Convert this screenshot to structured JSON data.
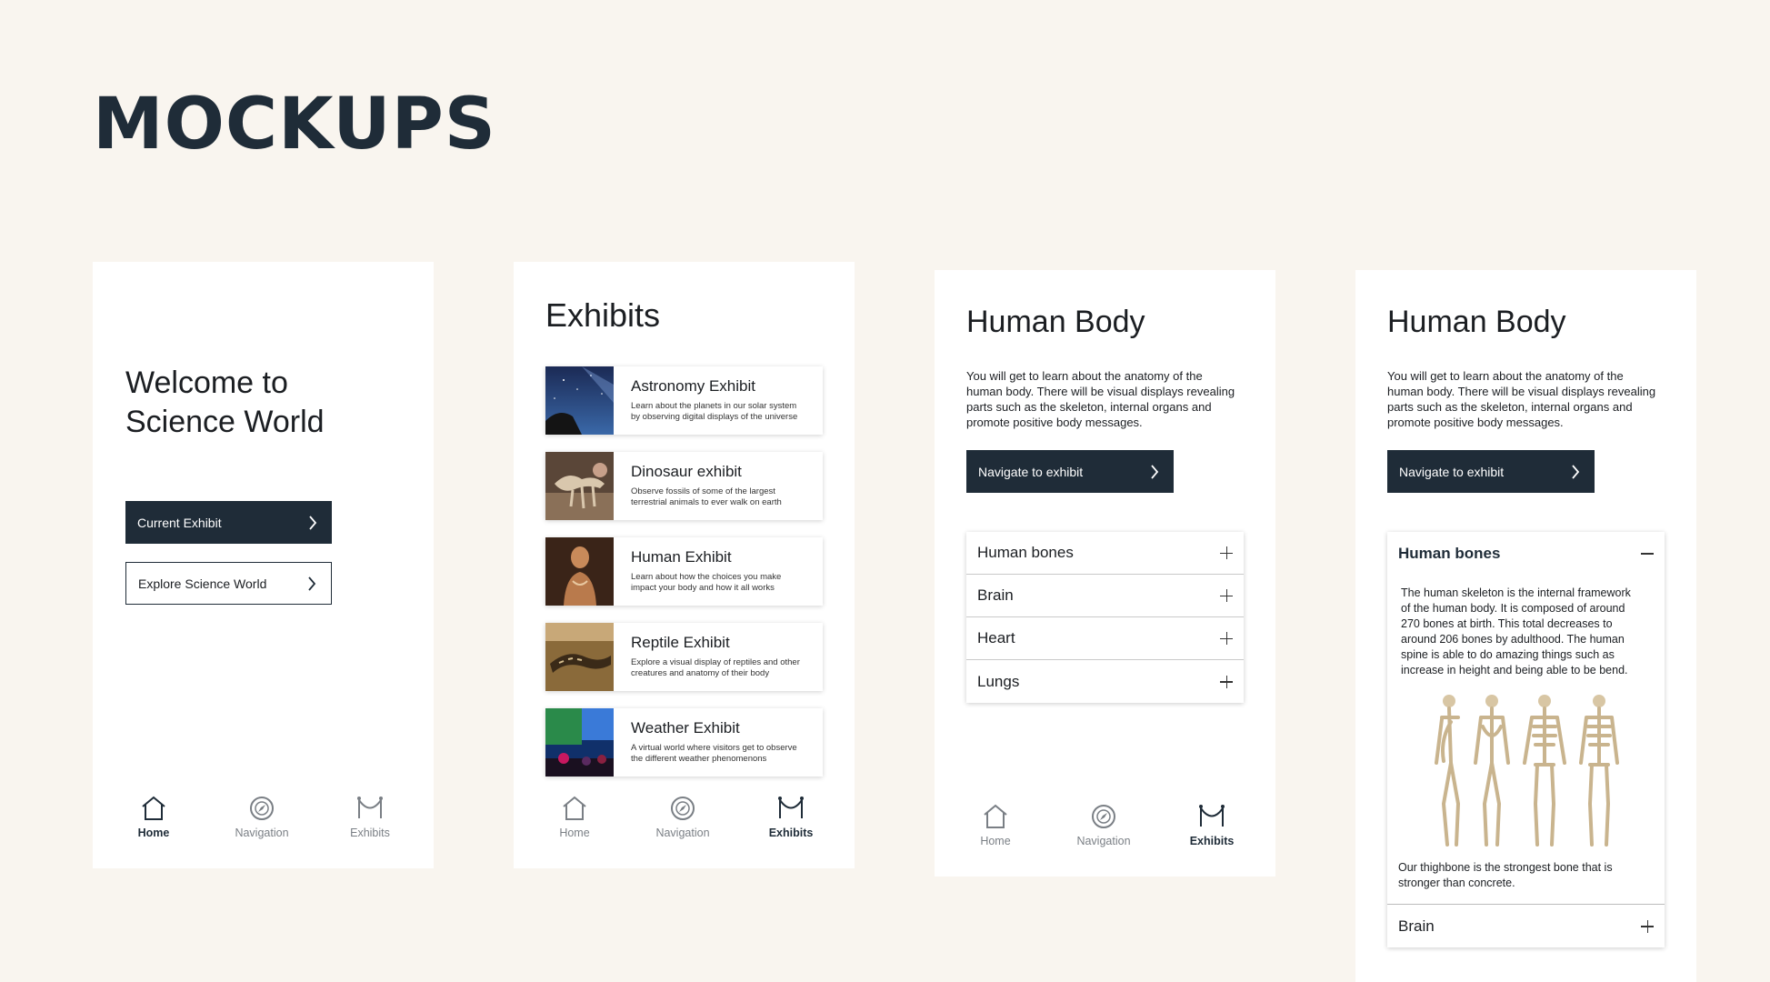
{
  "heading": "MOCKUPS",
  "nav": {
    "home": "Home",
    "navigation": "Navigation",
    "exhibits": "Exhibits"
  },
  "home_screen": {
    "welcome_line1": "Welcome to",
    "welcome_line2": "Science World",
    "current_exhibit_button": "Current Exhibit",
    "explore_button": "Explore Science World"
  },
  "exhibits_screen": {
    "title": "Exhibits",
    "cards": [
      {
        "title": "Astronomy Exhibit",
        "line1": "Learn about the planets in our solar system",
        "line2": "by observing digital displays of the universe"
      },
      {
        "title": "Dinosaur exhibit",
        "line1": "Observe fossils of some of the largest",
        "line2": "terrestrial animals to ever walk on earth"
      },
      {
        "title": "Human Exhibit",
        "line1": "Learn about how the choices you make",
        "line2": "impact your body and how it all works"
      },
      {
        "title": "Reptile Exhibit",
        "line1": "Explore a visual display of reptiles and other",
        "line2": "creatures and anatomy of their body"
      },
      {
        "title": "Weather Exhibit",
        "line1": "A virtual world where visitors get to observe",
        "line2": "the different weather phenomenons"
      }
    ]
  },
  "human_body_screen": {
    "title": "Human Body",
    "description_lines": [
      "You will get to learn about the anatomy of the",
      "human body. There will be visual displays revealing",
      "parts such as the skeleton, internal organs and",
      "promote positive body messages."
    ],
    "navigate_button": "Navigate to exhibit",
    "accordion": [
      "Human bones",
      "Brain",
      "Heart",
      "Lungs"
    ]
  },
  "human_bones_detail": {
    "title": "Human Body",
    "open_section": "Human bones",
    "body_lines": [
      "The human skeleton is the internal framework",
      "of the human body. It is composed of around",
      "270 bones at birth. This total decreases to",
      "around 206 bones by adulthood. The human",
      "spine is able to do amazing things such as",
      "increase in height and being able to be bend."
    ],
    "note_lines": [
      "Our thighbone is the strongest bone that is",
      "stronger than concrete."
    ],
    "next_section": "Brain"
  },
  "colors": {
    "background": "#f9f5ef",
    "primary": "#1f2c38",
    "card": "#ffffff"
  }
}
